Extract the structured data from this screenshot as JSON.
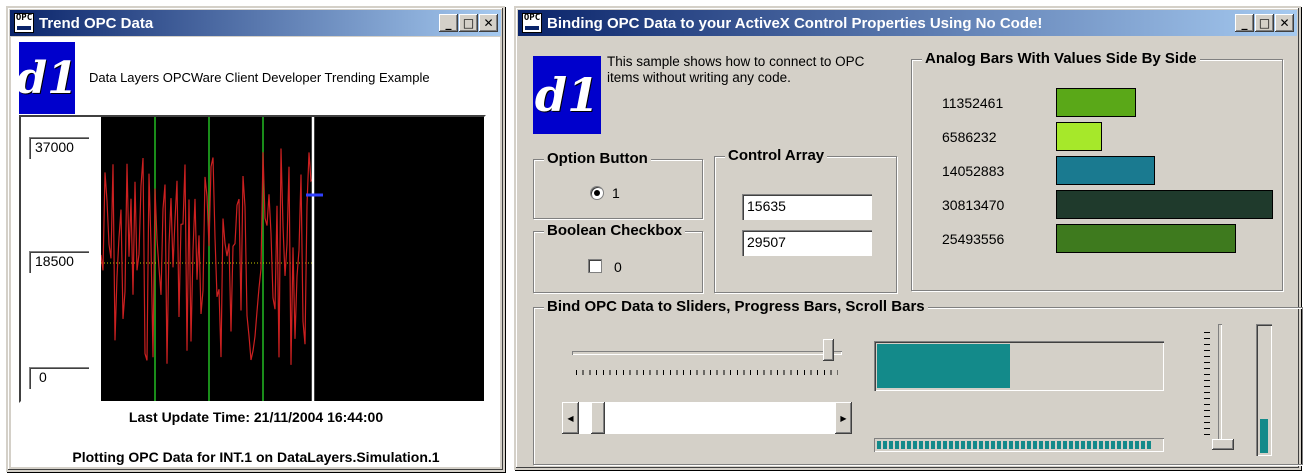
{
  "trend_window": {
    "title": "Trend OPC Data",
    "description": "Data Layers OPCWare Client Developer Trending Example",
    "y_axis_max": "37000",
    "y_axis_mid": "18500",
    "y_axis_min": "0",
    "last_update": "Last Update Time: 21/11/2004 16:44:00",
    "plotting_text": "Plotting OPC Data for INT.1 on DataLayers.Simulation.1",
    "colors": {
      "plot_bg": "#000000",
      "trace": "#cc2020",
      "grid": "#22bb22",
      "cursor": "#ffffff",
      "midline": "#c8c800"
    }
  },
  "binding_window": {
    "title": "Binding OPC Data to your ActiveX Control Properties Using No Code!",
    "intro": "This sample shows how to connect to OPC items without writing any code.",
    "option_group": {
      "title": "Option Button",
      "option_label": "1",
      "checked": true
    },
    "checkbox_group": {
      "title": "Boolean Checkbox",
      "checkbox_label": "0",
      "checked": false
    },
    "control_array": {
      "title": "Control Array",
      "values": [
        "15635",
        "29507"
      ]
    },
    "analog_bars": {
      "title": "Analog Bars With Values Side By Side",
      "max_value": 31500000,
      "items": [
        {
          "label": "11352461",
          "value": 11352461,
          "color": "#5aa818"
        },
        {
          "label": "6586232",
          "value": 6586232,
          "color": "#a6e82a"
        },
        {
          "label": "14052883",
          "value": 14052883,
          "color": "#1a7a90"
        },
        {
          "label": "30813470",
          "value": 30813470,
          "color": "#1f3a2c"
        },
        {
          "label": "25493556",
          "value": 25493556,
          "color": "#3e7a1e"
        }
      ]
    },
    "sliders_group": {
      "title": "Bind OPC Data to Sliders, Progress Bars, Scroll Bars",
      "h_slider_level": 0.97,
      "h_scroll_level": 0.05,
      "progress_fill": 0.47,
      "segmented_progress_fill": 0.97,
      "v_slider_level": 0.0,
      "v_progress_fill": 0.27,
      "accent": "#138a8a"
    }
  }
}
